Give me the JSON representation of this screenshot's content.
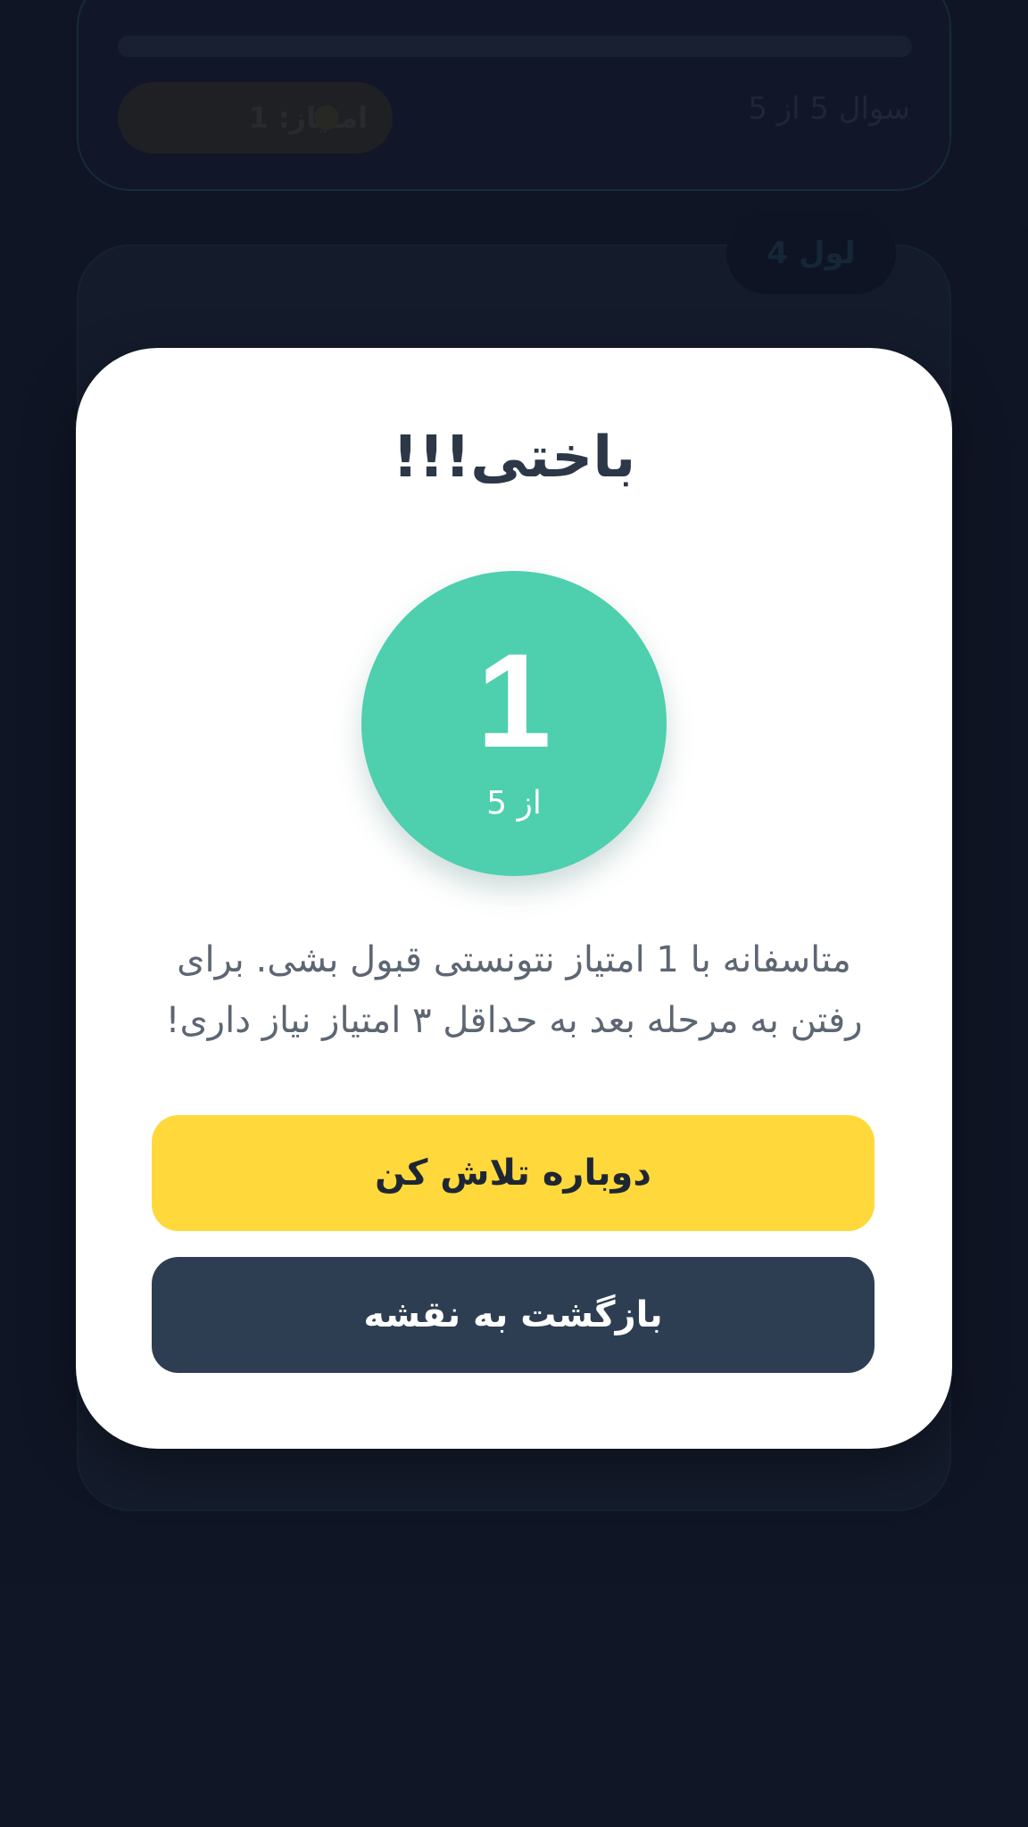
{
  "background": {
    "score_label": "امتیاز: 1",
    "question_counter": "سوال 5 از 5",
    "level_badge": "لول 4"
  },
  "modal": {
    "title": "باختی!!!",
    "score_value": "1",
    "score_total": "از 5",
    "message": "متاسفانه با 1 امتیاز نتونستی قبول بشی. برای رفتن به مرحله بعد به حداقل ۳ امتیاز نیاز داری!",
    "retry_label": "دوباره تلاش کن",
    "back_label": "بازگشت به نقشه"
  },
  "colors": {
    "score_circle": "#4ecfae",
    "retry_button": "#ffd93b",
    "back_button": "#2e3e52",
    "page_background": "#141a2c"
  },
  "icons": [
    "star-icon"
  ]
}
